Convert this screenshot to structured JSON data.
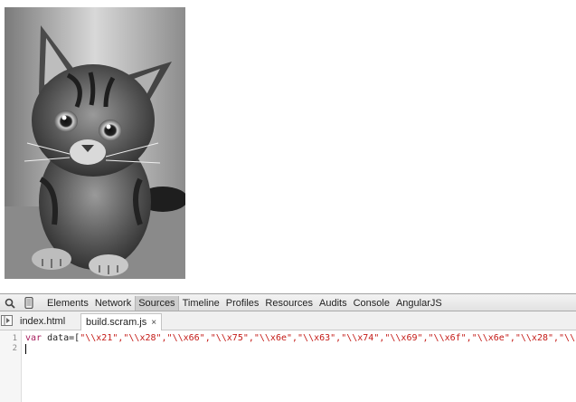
{
  "page": {
    "image_alt": "kitten photo"
  },
  "devtools": {
    "panels": [
      "Elements",
      "Network",
      "Sources",
      "Timeline",
      "Profiles",
      "Resources",
      "Audits",
      "Console",
      "AngularJS"
    ],
    "active_panel": "Sources",
    "files": [
      {
        "name": "index.html",
        "active": false
      },
      {
        "name": "build.scram.js",
        "active": true
      }
    ],
    "close_glyph": "×",
    "editor": {
      "line_numbers": [
        "1",
        "2"
      ],
      "line1_keyword": "var",
      "line1_plain": " data=[",
      "line1_strings": "\"\\\\x21\",\"\\\\x28\",\"\\\\x66\",\"\\\\x75\",\"\\\\x6e\",\"\\\\x63\",\"\\\\x74\",\"\\\\x69\",\"\\\\x6f\",\"\\\\x6e\",\"\\\\x28\",\"\\\\"
    }
  },
  "colors": {
    "keyword": "#a71d5d",
    "string": "#c41a16",
    "toolbar_bg": "#e6e6e6"
  },
  "icons": [
    "search-icon",
    "device-mode-icon",
    "navigator-toggle-icon",
    "close-icon"
  ]
}
